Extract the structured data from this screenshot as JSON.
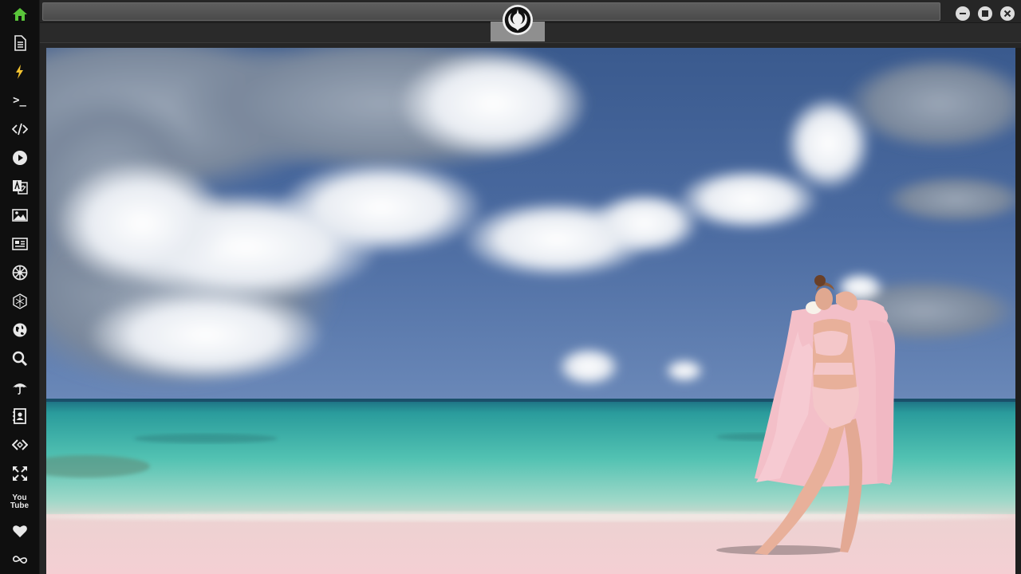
{
  "app": {
    "title": ""
  },
  "sidebar": {
    "items": [
      {
        "name": "home-icon",
        "active": true,
        "color": "#5ac53a"
      },
      {
        "name": "document-icon"
      },
      {
        "name": "lightning-icon",
        "color": "#f2c230"
      },
      {
        "name": "terminal-icon",
        "text": ">_"
      },
      {
        "name": "code-icon"
      },
      {
        "name": "play-icon"
      },
      {
        "name": "translate-icon"
      },
      {
        "name": "image-icon"
      },
      {
        "name": "newspaper-icon"
      },
      {
        "name": "empire-icon"
      },
      {
        "name": "death-star-icon"
      },
      {
        "name": "globe-icon"
      },
      {
        "name": "search-icon"
      },
      {
        "name": "umbrella-icon"
      },
      {
        "name": "contacts-icon"
      },
      {
        "name": "embed-code-icon"
      },
      {
        "name": "fullscreen-icon"
      },
      {
        "name": "youtube-icon",
        "text_top": "You",
        "text_bottom": "Tube"
      },
      {
        "name": "heart-icon"
      },
      {
        "name": "infinity-icon"
      }
    ]
  },
  "topbar": {
    "logo": "rebel-alliance-icon",
    "window_buttons": [
      "minimize-icon",
      "maximize-icon",
      "close-icon"
    ]
  },
  "content": {
    "image": "beach-photo",
    "colors": {
      "sky": "#3f6398",
      "sea": "#4fc0b2",
      "sand": "#f2cfd2",
      "robe": "#f3c0c8"
    }
  }
}
